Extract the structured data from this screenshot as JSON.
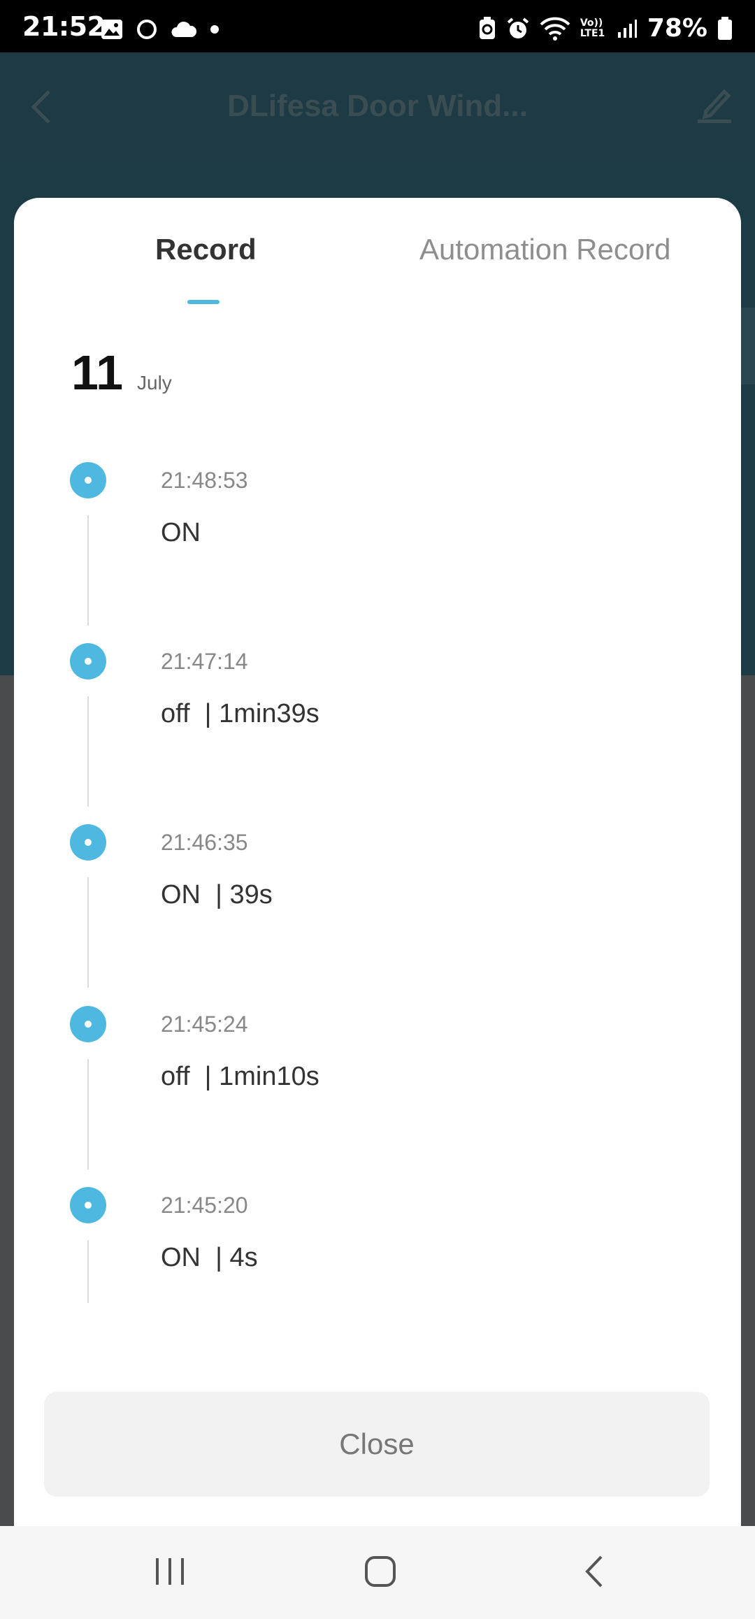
{
  "status_bar": {
    "time": "21:52",
    "battery": "78%",
    "network_label": "Vo)) LTE1"
  },
  "app_bar": {
    "title": "DLifesa Door Wind..."
  },
  "sheet": {
    "tabs": [
      {
        "label": "Record",
        "active": true
      },
      {
        "label": "Automation Record",
        "active": false
      }
    ],
    "date": {
      "day": "11",
      "month": "July"
    },
    "events": [
      {
        "time": "21:48:53",
        "state": "ON"
      },
      {
        "time": "21:47:14",
        "state": "off  | 1min39s"
      },
      {
        "time": "21:46:35",
        "state": "ON  | 39s"
      },
      {
        "time": "21:45:24",
        "state": "off  | 1min10s"
      },
      {
        "time": "21:45:20",
        "state": "ON  | 4s"
      }
    ],
    "close_label": "Close"
  },
  "colors": {
    "accent": "#4fb8e0",
    "appbar_dim": "#1e3a44",
    "overlay": "#4a4b4d"
  }
}
